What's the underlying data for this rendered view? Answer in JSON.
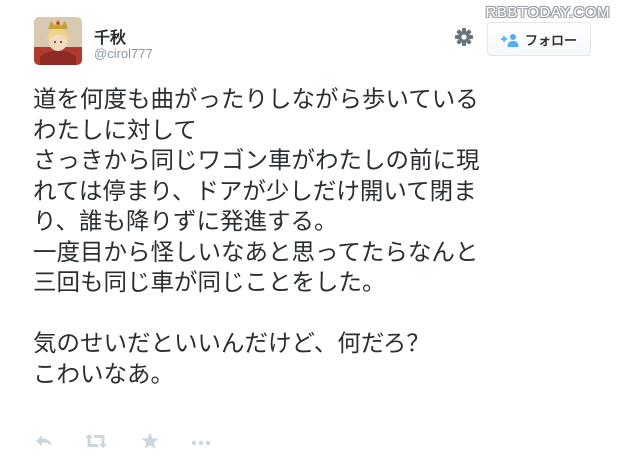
{
  "watermark": "RBBTODAY.COM",
  "user": {
    "name": "千秋",
    "handle": "@cirol777"
  },
  "follow_button": {
    "label": "フォロー"
  },
  "icons": {
    "gear": "gear-icon",
    "follow": "add-person-icon",
    "reply": "reply-icon",
    "retweet": "retweet-icon",
    "favorite": "star-icon",
    "more": "more-icon"
  },
  "colors": {
    "text": "#292f33",
    "muted": "#8899a6",
    "icon": "#ccd6dd",
    "border": "#e1e8ed"
  },
  "tweet": {
    "lines": [
      "道を何度も曲がったりしながら歩いている",
      "わたしに対して",
      "さっきから同じワゴン車がわたしの前に現",
      "れては停まり、ドアが少しだけ開いて閉ま",
      "り、誰も降りずに発進する。",
      "一度目から怪しいなあと思ってたらなんと",
      "三回も同じ車が同じことをした。",
      "",
      "気のせいだといいんだけど、何だろ？",
      "こわいなあ。"
    ]
  }
}
